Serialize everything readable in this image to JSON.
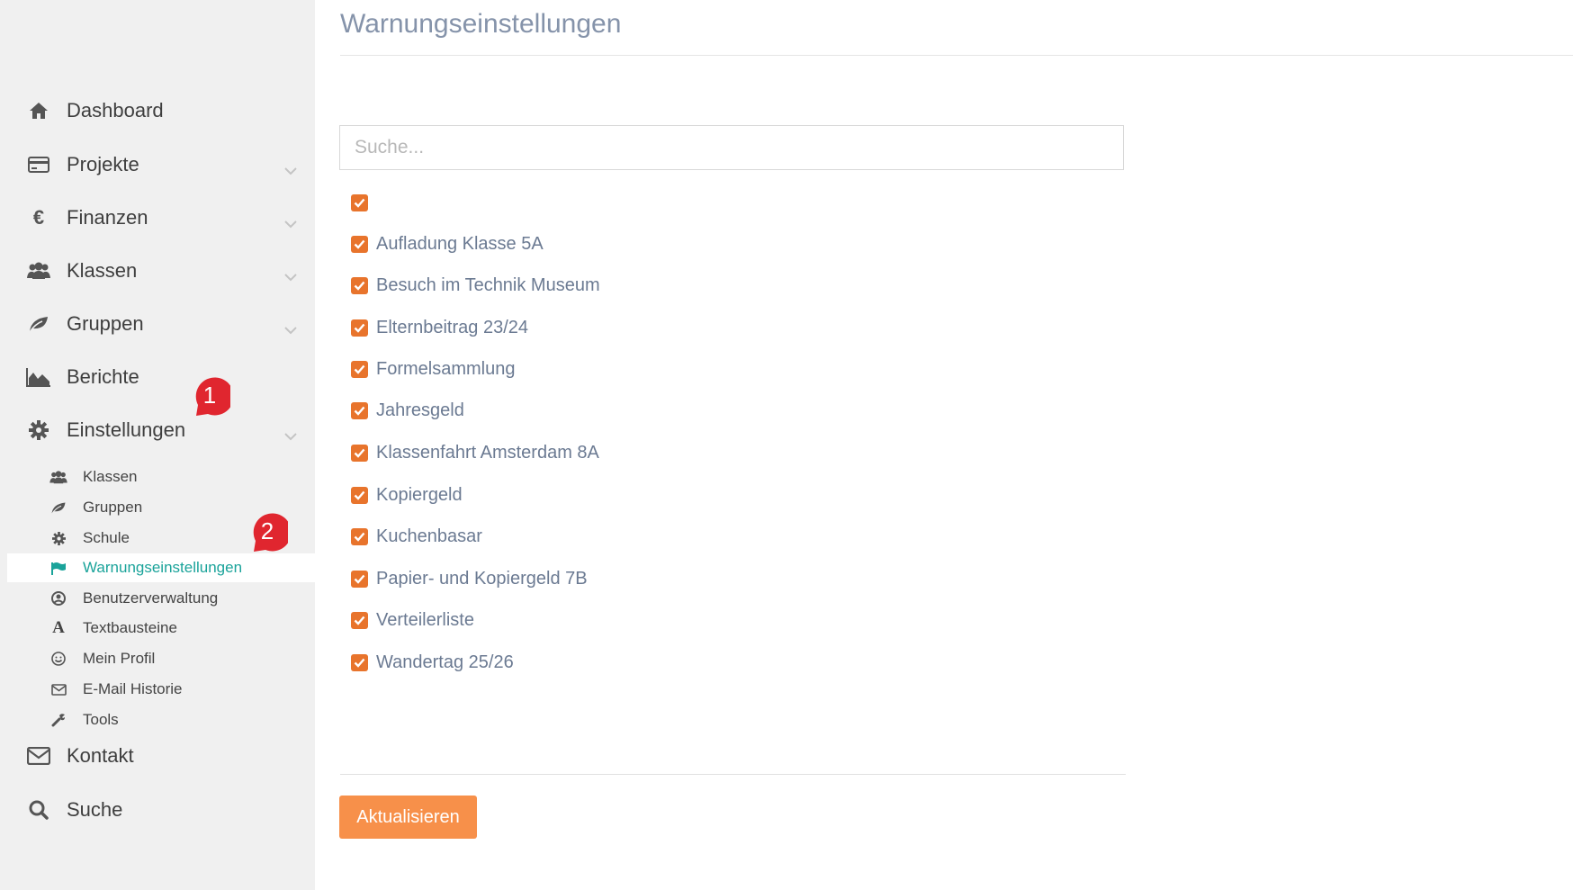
{
  "sidebar": {
    "items": [
      {
        "label": "Dashboard",
        "icon": "home-icon"
      },
      {
        "label": "Projekte",
        "icon": "credit-card-icon"
      },
      {
        "label": "Finanzen",
        "icon": "euro-icon"
      },
      {
        "label": "Klassen",
        "icon": "users-icon"
      },
      {
        "label": "Gruppen",
        "icon": "leaf-icon"
      },
      {
        "label": "Berichte",
        "icon": "area-chart-icon"
      },
      {
        "label": "Einstellungen",
        "icon": "gear-icon"
      },
      {
        "label": "Kontakt",
        "icon": "envelope-icon"
      },
      {
        "label": "Suche",
        "icon": "search-icon"
      }
    ],
    "submenu": [
      {
        "label": "Klassen",
        "icon": "users-icon"
      },
      {
        "label": "Gruppen",
        "icon": "leaf-icon"
      },
      {
        "label": "Schule",
        "icon": "gear-icon"
      },
      {
        "label": "Warnungseinstellungen",
        "icon": "flag-icon",
        "active": true
      },
      {
        "label": "Benutzerverwaltung",
        "icon": "user-circle-icon"
      },
      {
        "label": "Textbausteine",
        "icon": "font-icon"
      },
      {
        "label": "Mein Profil",
        "icon": "smiley-icon"
      },
      {
        "label": "E-Mail Historie",
        "icon": "envelope-icon"
      },
      {
        "label": "Tools",
        "icon": "wrench-icon"
      }
    ],
    "badges": [
      "1",
      "2"
    ]
  },
  "main": {
    "title": "Warnungseinstellungen",
    "search_placeholder": "Suche...",
    "checkboxes": [
      {
        "label": "",
        "checked": true
      },
      {
        "label": "Aufladung Klasse 5A",
        "checked": true
      },
      {
        "label": "Besuch im Technik Museum",
        "checked": true
      },
      {
        "label": "Elternbeitrag 23/24",
        "checked": true
      },
      {
        "label": "Formelsammlung",
        "checked": true
      },
      {
        "label": "Jahresgeld",
        "checked": true
      },
      {
        "label": "Klassenfahrt Amsterdam 8A",
        "checked": true
      },
      {
        "label": "Kopiergeld",
        "checked": true
      },
      {
        "label": "Kuchenbasar",
        "checked": true
      },
      {
        "label": "Papier- und Kopiergeld 7B",
        "checked": true
      },
      {
        "label": "Verteilerliste",
        "checked": true
      },
      {
        "label": "Wandertag 25/26",
        "checked": true
      }
    ],
    "submit_label": "Aktualisieren"
  },
  "colors": {
    "accent": "#e8742c",
    "button": "#f7904a",
    "active_link": "#1aa39a",
    "badge": "#e0262f"
  }
}
